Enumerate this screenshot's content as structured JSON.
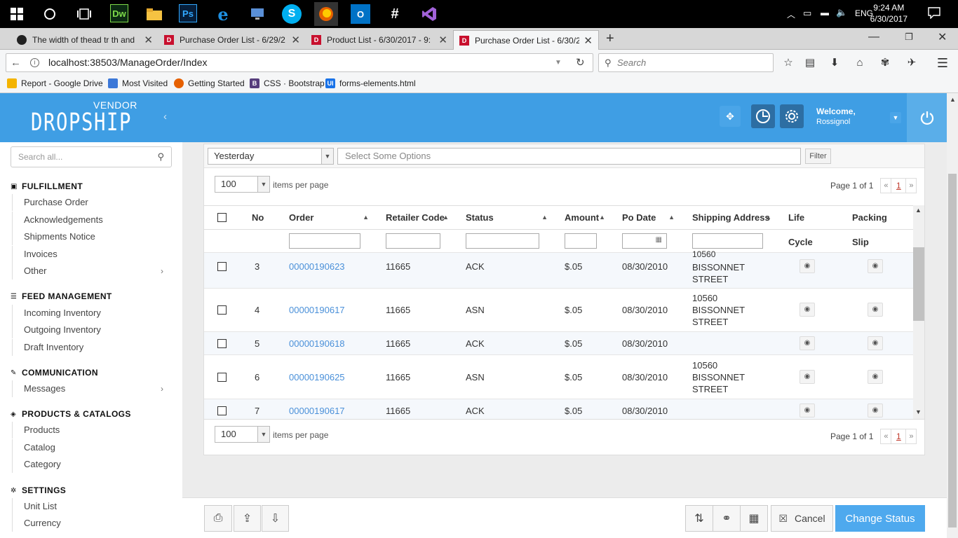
{
  "taskbar": {
    "apps": [
      "Dw",
      "Ps"
    ],
    "language": "ENG",
    "time": "9:24 AM",
    "date": "6/30/2017"
  },
  "browser": {
    "tabs": [
      {
        "title": "The width of thead tr th and",
        "active": false
      },
      {
        "title": "Purchase Order List - 6/29/2",
        "active": false
      },
      {
        "title": "Product List - 6/30/2017 - 9:",
        "active": false
      },
      {
        "title": "Purchase Order List - 6/30/2",
        "active": true
      }
    ],
    "url": "localhost:38503/ManageOrder/Index",
    "search_placeholder": "Search",
    "bookmarks": [
      "Report - Google Drive",
      "Most Visited",
      "Getting Started",
      "CSS · Bootstrap",
      "forms-elements.html"
    ]
  },
  "app": {
    "brand_top": "VENDOR",
    "brand_main": "DROPSHIP",
    "welcome": "Welcome,",
    "user": "Rossignol"
  },
  "sidebar": {
    "search_placeholder": "Search all...",
    "sections": [
      {
        "title": "FULFILLMENT",
        "items": [
          "Purchase Order",
          "Acknowledgements",
          "Shipments Notice",
          "Invoices",
          "Other"
        ]
      },
      {
        "title": "FEED MANAGEMENT",
        "items": [
          "Incoming Inventory",
          "Outgoing Inventory",
          "Draft Inventory"
        ]
      },
      {
        "title": "COMMUNICATION",
        "items": [
          "Messages"
        ]
      },
      {
        "title": "PRODUCTS & CATALOGS",
        "items": [
          "Products",
          "Catalog",
          "Category"
        ]
      },
      {
        "title": "SETTINGS",
        "items": [
          "Unit List",
          "Currency"
        ]
      }
    ]
  },
  "filters": {
    "date_range": "Yesterday",
    "options_placeholder": "Select Some Options",
    "filter_button": "Filter"
  },
  "paging": {
    "per_page": "100",
    "per_page_label": "items per page",
    "page_info": "Page 1 of 1",
    "current_page": "1",
    "prev": "«",
    "next": "»"
  },
  "table": {
    "columns": [
      "No",
      "Order",
      "Retailer Code",
      "Status",
      "Amount",
      "Po Date",
      "Shipping Address",
      "Life Cycle",
      "Packing Slip"
    ],
    "partial_address_top": "10560",
    "rows": [
      {
        "no": "3",
        "order": "00000190623",
        "retailer": "11665",
        "status": "ACK",
        "amount": "$.05",
        "po_date": "08/30/2010",
        "addr": [
          "BISSONNET",
          "STREET"
        ]
      },
      {
        "no": "4",
        "order": "00000190617",
        "retailer": "11665",
        "status": "ASN",
        "amount": "$.05",
        "po_date": "08/30/2010",
        "addr": [
          "10560",
          "BISSONNET",
          "STREET"
        ]
      },
      {
        "no": "5",
        "order": "00000190618",
        "retailer": "11665",
        "status": "ACK",
        "amount": "$.05",
        "po_date": "08/30/2010",
        "addr": []
      },
      {
        "no": "6",
        "order": "00000190625",
        "retailer": "11665",
        "status": "ASN",
        "amount": "$.05",
        "po_date": "08/30/2010",
        "addr": [
          "10560",
          "BISSONNET",
          "STREET"
        ]
      },
      {
        "no": "7",
        "order": "00000190617",
        "retailer": "11665",
        "status": "ACK",
        "amount": "$.05",
        "po_date": "08/30/2010",
        "addr": []
      }
    ]
  },
  "actions": {
    "cancel": "Cancel",
    "change_status": "Change Status"
  },
  "colors": {
    "brand_blue": "#3f9ee4",
    "primary_button": "#4ea9ee",
    "link": "#4a90d9",
    "taskbar": "#000000"
  }
}
